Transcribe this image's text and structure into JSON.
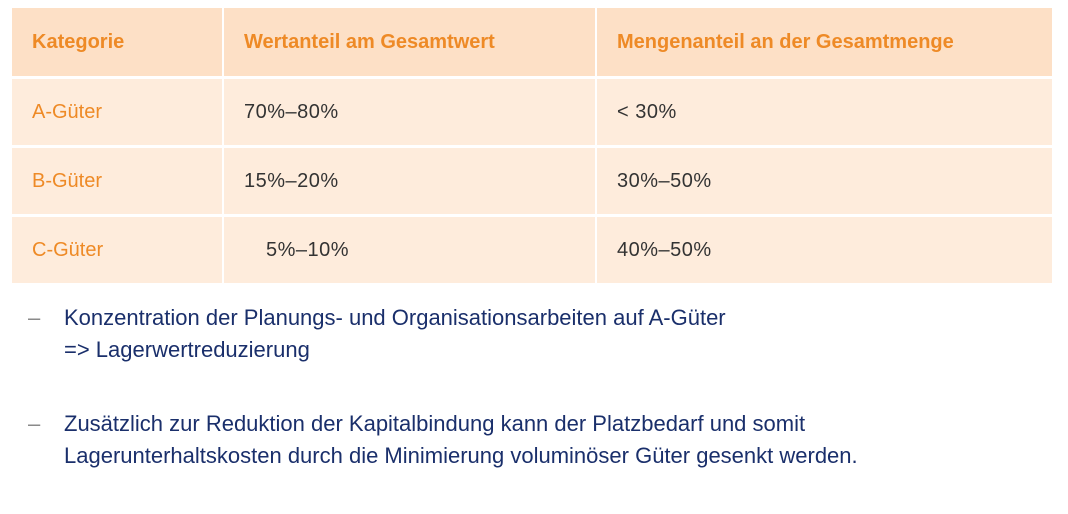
{
  "table": {
    "headers": [
      "Kategorie",
      "Wertanteil am Gesamtwert",
      "Mengenanteil an der Gesamtmenge"
    ],
    "rows": [
      {
        "category": "A-Güter",
        "value_share": "70%–80%",
        "quantity_share": "< 30%"
      },
      {
        "category": "B-Güter",
        "value_share": "15%–20%",
        "quantity_share": "30%–50%"
      },
      {
        "category": "C-Güter",
        "value_share": "5%–10%",
        "quantity_share": "40%–50%"
      }
    ]
  },
  "bullets": [
    {
      "marker": "–",
      "line1": "Konzentration der Planungs- und Organisationsarbeiten auf A-Güter",
      "line2": "=> Lagerwertreduzierung"
    },
    {
      "marker": "–",
      "line1": "Zusätzlich zur Reduktion der Kapitalbindung kann der Platzbedarf und somit",
      "line2": "Lagerunterhaltskosten durch die Minimierung voluminöser Güter gesenkt werden."
    }
  ],
  "colors": {
    "header_bg": "#fde0c6",
    "row_bg": "#feecdc",
    "accent_orange": "#ee8a26",
    "text_dark": "#333333",
    "bullet_blue": "#1a2f6b"
  }
}
